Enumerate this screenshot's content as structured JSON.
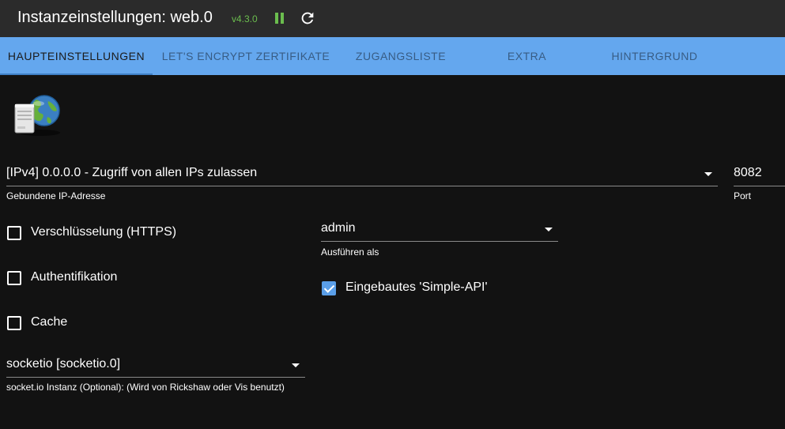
{
  "header": {
    "title": "Instanzeinstellungen: web.0",
    "version": "v4.3.0",
    "pause_icon": "pause-icon",
    "reload_icon": "reload-icon"
  },
  "tabs": [
    {
      "label": "HAUPTEINSTELLUNGEN",
      "active": true
    },
    {
      "label": "LET'S ENCRYPT ZERTIFIKATE",
      "active": false
    },
    {
      "label": "ZUGANGSLISTE",
      "active": false
    },
    {
      "label": "EXTRA",
      "active": false
    },
    {
      "label": "HINTERGRUND",
      "active": false
    }
  ],
  "form": {
    "bind_ip": {
      "value": "[IPv4] 0.0.0.0 - Zugriff von allen IPs zulassen",
      "label": "Gebundene IP-Adresse"
    },
    "port": {
      "value": "8082",
      "label": "Port"
    },
    "https": {
      "label": "Verschlüsselung (HTTPS)",
      "checked": false
    },
    "auth": {
      "label": "Authentifikation",
      "checked": false
    },
    "cache": {
      "label": "Cache",
      "checked": false
    },
    "run_as": {
      "value": "admin",
      "label": "Ausführen als"
    },
    "simple_api": {
      "label": "Eingebautes 'Simple-API'",
      "checked": true
    },
    "socketio": {
      "value": "socketio [socketio.0]",
      "label": "socket.io Instanz (Optional): (Wird von Rickshaw oder Vis benutzt)"
    }
  },
  "colors": {
    "accent": "#64a7ee",
    "checkbox_checked": "#5a9ee8",
    "version_green": "#6bbd4e",
    "background": "#121212",
    "titlebar": "#2b2b2b"
  }
}
